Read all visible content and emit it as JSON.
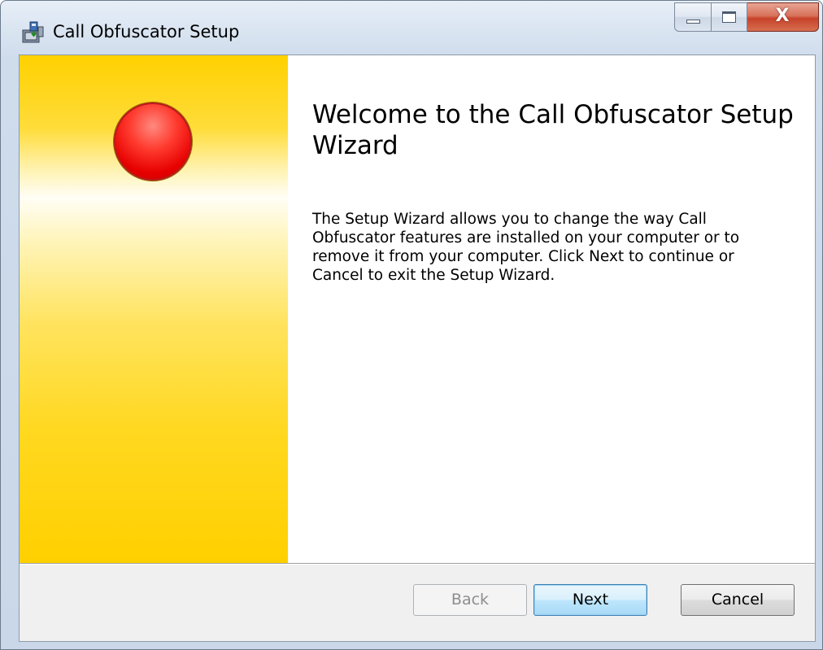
{
  "window": {
    "title": "Call Obfuscator Setup",
    "icon": "installer-icon",
    "caption_buttons": {
      "minimize_icon": "minimize-icon",
      "maximize_icon": "maximize-icon",
      "close_icon": "close-icon",
      "close_glyph": "X"
    }
  },
  "banner": {
    "graphic": "red-circle",
    "colors": {
      "banner_yellow": "#ffd100",
      "circle_red": "#e60000"
    }
  },
  "content": {
    "heading": "Welcome to the Call Obfuscator Setup Wizard",
    "body": "The Setup Wizard allows you to change the way Call Obfuscator features are installed on your computer or to remove it from your computer. Click Next to continue or Cancel to exit the Setup Wizard."
  },
  "footer": {
    "back_label": "Back",
    "back_enabled": false,
    "next_label": "Next",
    "next_default": true,
    "cancel_label": "Cancel"
  }
}
